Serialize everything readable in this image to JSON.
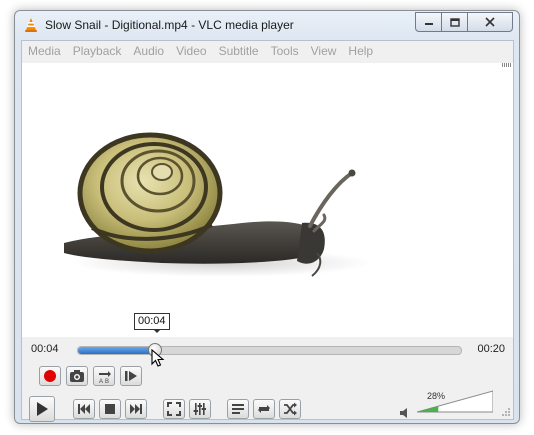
{
  "window": {
    "title": "Slow Snail - Digitional.mp4 - VLC media player"
  },
  "menu": [
    "Media",
    "Playback",
    "Audio",
    "Video",
    "Subtitle",
    "Tools",
    "View",
    "Help"
  ],
  "playback": {
    "elapsed": "00:04",
    "total": "00:20",
    "tooltip": "00:04",
    "progress": 0.2
  },
  "volume": {
    "label": "28%",
    "level": 0.28
  },
  "colors": {
    "accent": "#2a6fc4",
    "record": "#e00000",
    "volume": "#47b34a"
  }
}
